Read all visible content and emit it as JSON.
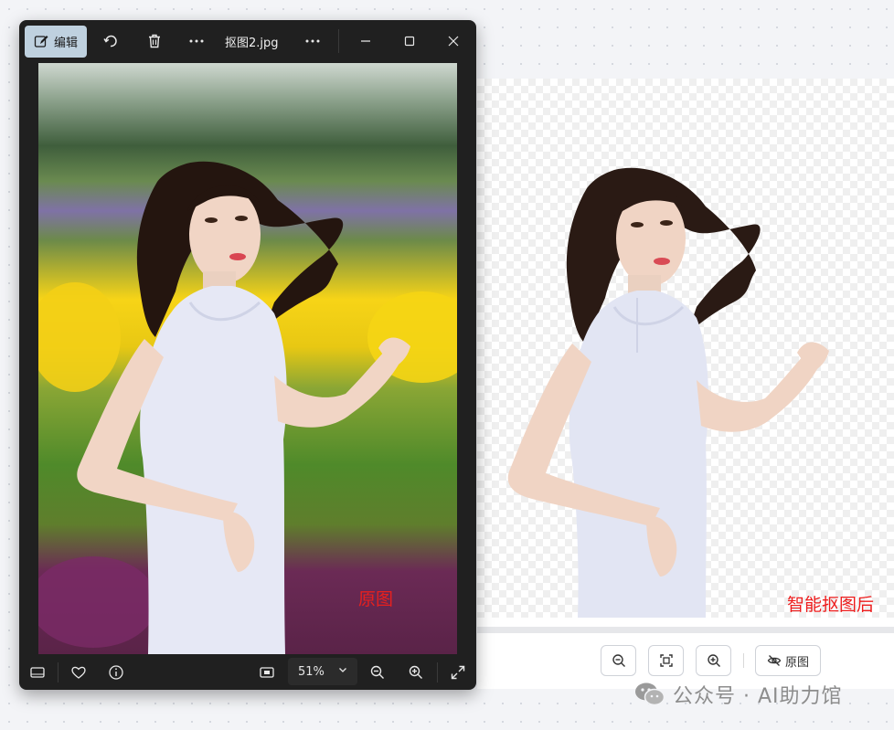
{
  "viewer": {
    "edit_label": "编辑",
    "filename": "抠图2.jpg",
    "zoom": "51%",
    "photo_label": "原图"
  },
  "editor": {
    "result_label": "智能抠图后",
    "original_button_label": "原图"
  },
  "watermark": {
    "text": "公众号 · AI助力馆"
  },
  "colors": {
    "label_red": "#ee1c1c",
    "viewer_bg": "#202020",
    "edit_highlight": "#bfd1df"
  }
}
